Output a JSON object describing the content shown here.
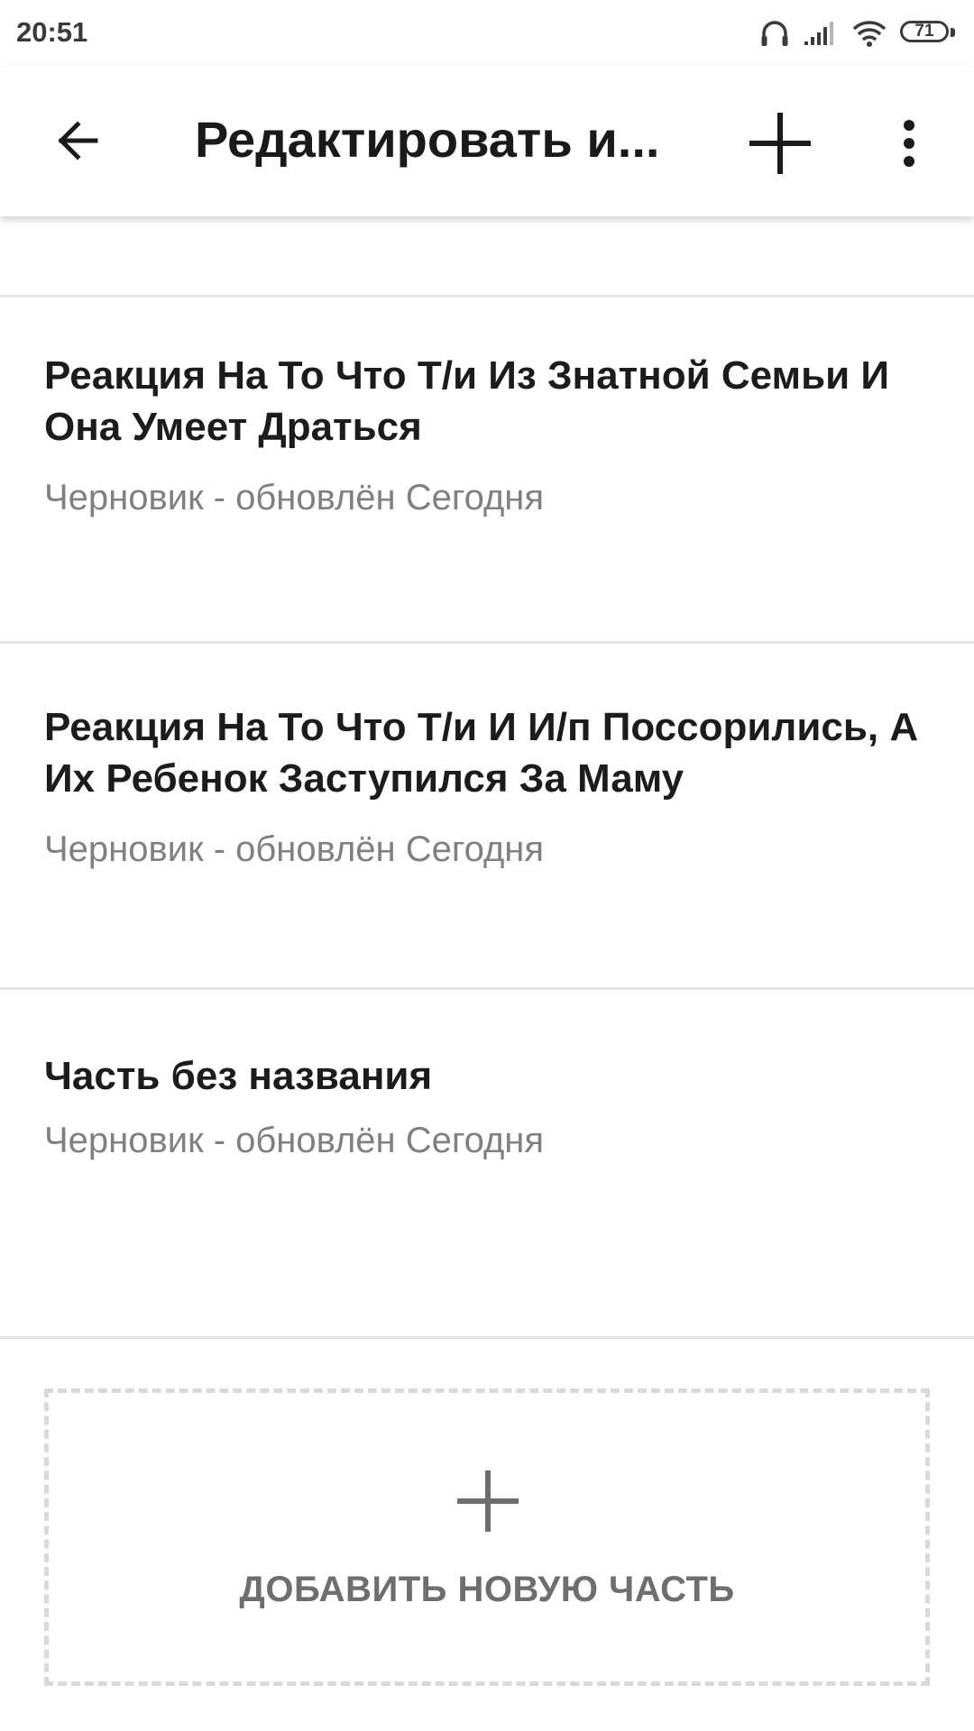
{
  "status_bar": {
    "time": "20:51",
    "battery": "71",
    "icons": [
      "headphones-icon",
      "signal-icon",
      "wifi-icon",
      "battery-icon"
    ]
  },
  "toolbar": {
    "title": "Редактировать и...",
    "back_icon": "arrow-left-icon",
    "add_icon": "plus-icon",
    "more_icon": "more-vertical-icon"
  },
  "parts": [
    {
      "title": "Реакция На То Что Т/и Из Знатной Семьи И Она Умеет Драться",
      "status": "Черновик - обновлён Сегодня"
    },
    {
      "title": "Реакция На То Что Т/и И И/п Поссорились, А Их Ребенок Заступился За Маму",
      "status": "Черновик - обновлён Сегодня"
    },
    {
      "title": "Часть без названия",
      "status": "Черновик - обновлён Сегодня"
    }
  ],
  "add_part": {
    "label": "ДОБАВИТЬ НОВУЮ ЧАСТЬ",
    "icon": "plus-icon"
  },
  "colors": {
    "text_primary": "#1c1c1c",
    "text_secondary": "#808080",
    "divider": "#e4e4e4",
    "dashed_border": "#d9d9d9"
  }
}
